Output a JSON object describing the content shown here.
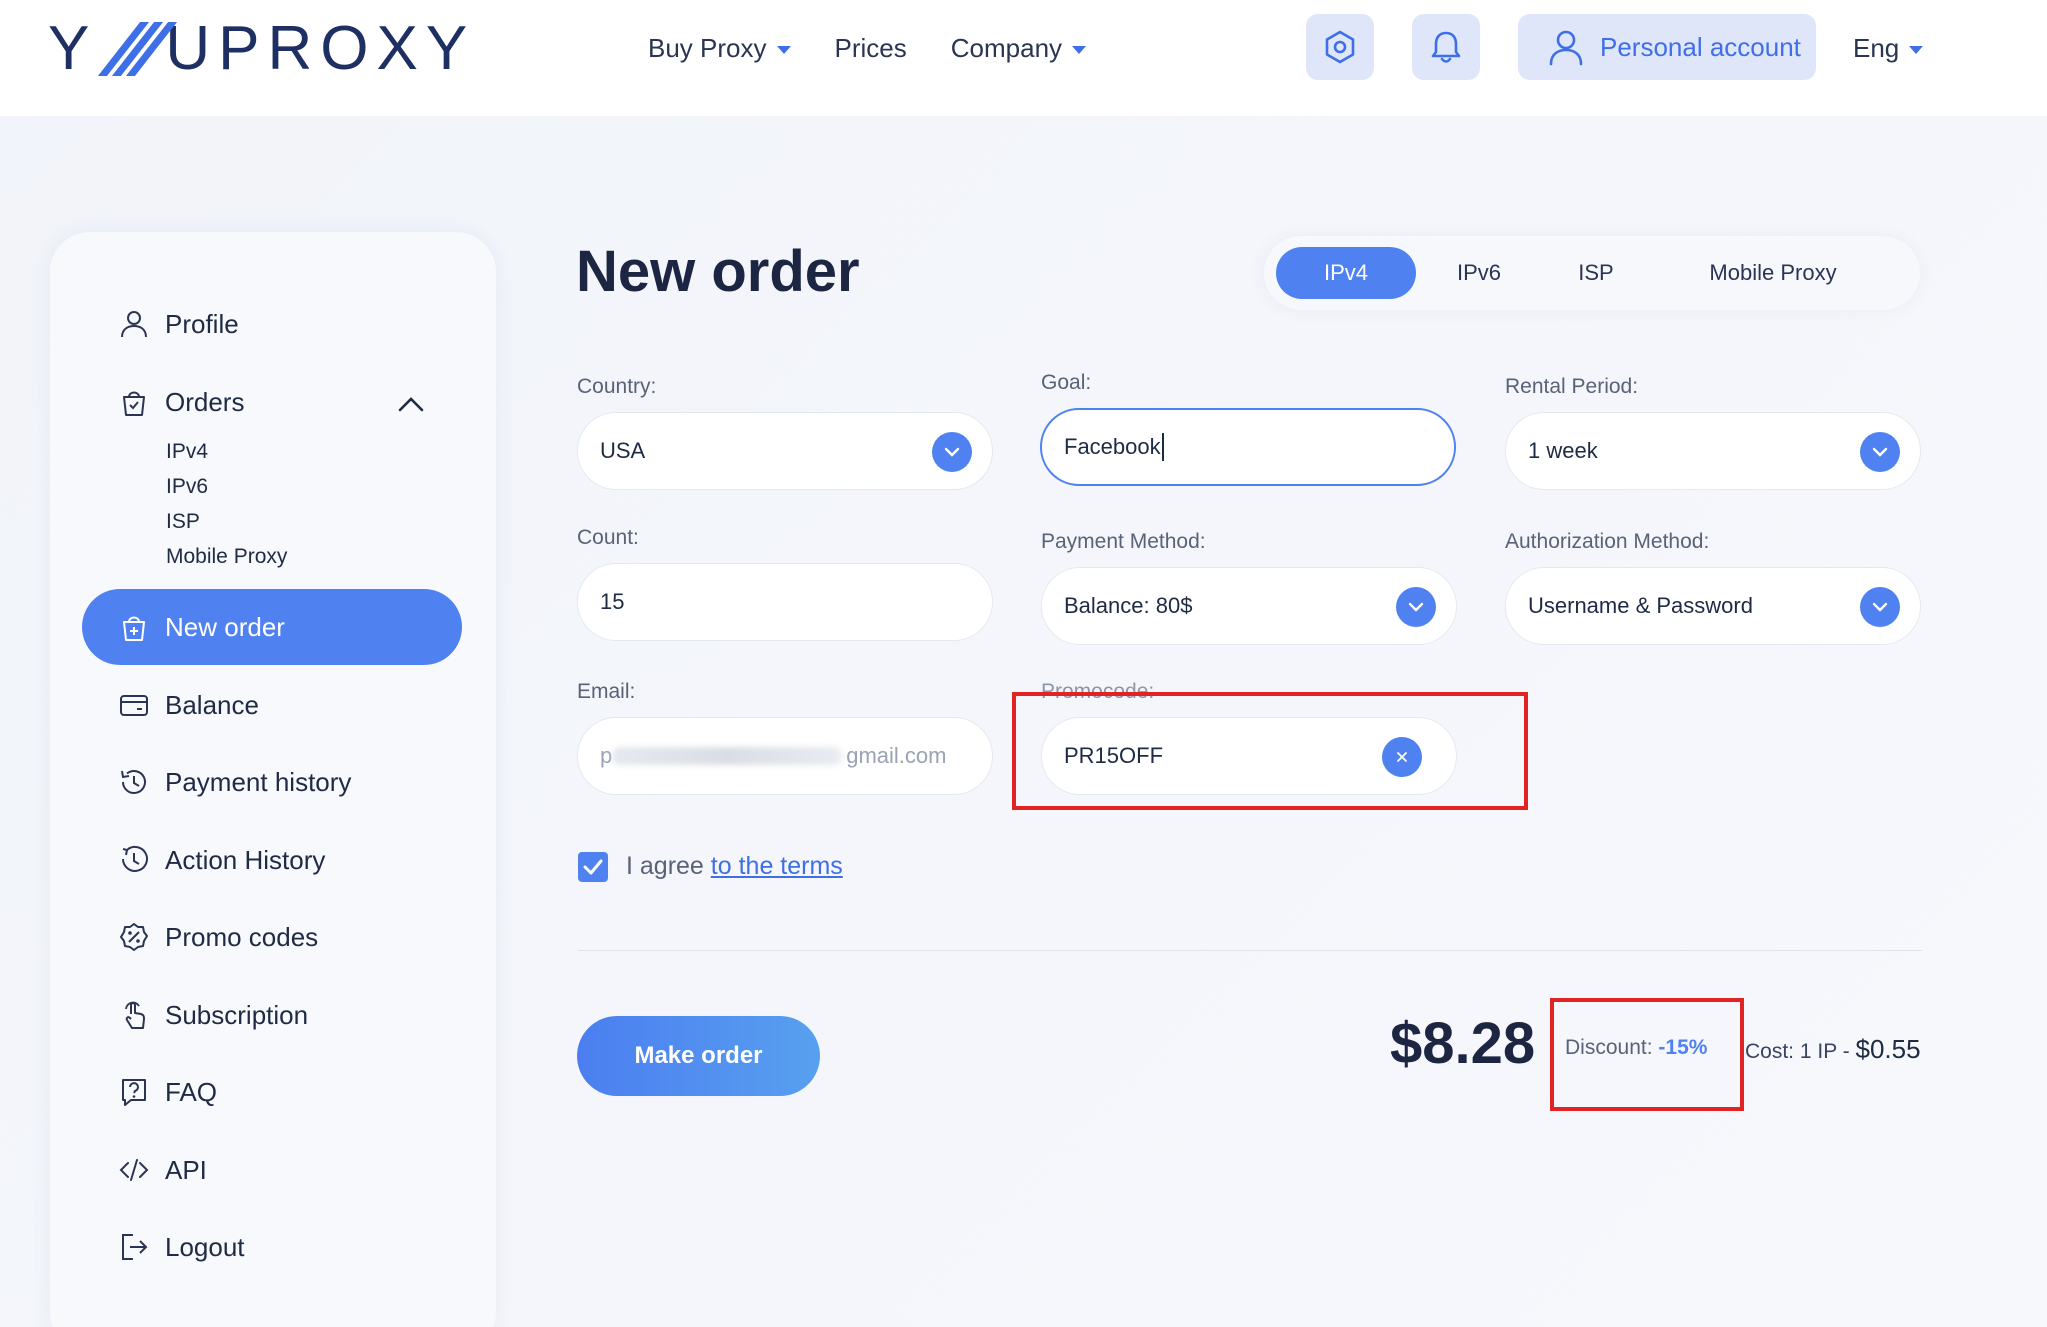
{
  "header": {
    "logo": {
      "left": "Y",
      "right": "UPROXY"
    },
    "nav": [
      {
        "label": "Buy Proxy",
        "dropdown": true
      },
      {
        "label": "Prices",
        "dropdown": false
      },
      {
        "label": "Company",
        "dropdown": true
      }
    ],
    "account_label": "Personal account",
    "language": "Eng"
  },
  "sidebar": {
    "items": [
      {
        "label": "Profile",
        "icon": "user-icon"
      },
      {
        "label": "Orders",
        "icon": "bag-icon"
      },
      {
        "label": "New order",
        "icon": "new-order-icon",
        "active": true
      },
      {
        "label": "Balance",
        "icon": "card-icon"
      },
      {
        "label": "Payment history",
        "icon": "history-icon"
      },
      {
        "label": "Action History",
        "icon": "clock-icon"
      },
      {
        "label": "Promo codes",
        "icon": "percent-badge-icon"
      },
      {
        "label": "Subscription",
        "icon": "touch-icon"
      },
      {
        "label": "FAQ",
        "icon": "question-icon"
      },
      {
        "label": "API",
        "icon": "code-icon"
      },
      {
        "label": "Logout",
        "icon": "logout-icon"
      }
    ],
    "order_subitems": [
      "IPv4",
      "IPv6",
      "ISP",
      "Mobile Proxy"
    ]
  },
  "main": {
    "title": "New order",
    "tabs": [
      {
        "label": "IPv4",
        "active": true
      },
      {
        "label": "IPv6",
        "active": false
      },
      {
        "label": "ISP",
        "active": false
      },
      {
        "label": "Mobile Proxy",
        "active": false
      }
    ],
    "form": {
      "country": {
        "label": "Country:",
        "value": "USA"
      },
      "goal": {
        "label": "Goal:",
        "value": "Facebook"
      },
      "rental_period": {
        "label": "Rental Period:",
        "value": "1 week"
      },
      "count": {
        "label": "Count:",
        "value": "15"
      },
      "payment_method": {
        "label": "Payment Method:",
        "value": "Balance: 80$"
      },
      "authorization_method": {
        "label": "Authorization Method:",
        "value": "Username & Password"
      },
      "email": {
        "label": "Email:",
        "value_prefix": "p",
        "value_suffix": "gmail.com"
      },
      "promocode": {
        "label": "Promocode:",
        "value": "PR15OFF"
      }
    },
    "terms": {
      "text": "I agree",
      "link": "to the terms",
      "checked": true
    },
    "order_button": "Make order",
    "total": "$8.28",
    "discount": {
      "label": "Discount:",
      "value": "-15%"
    },
    "cost": {
      "label": "Cost: 1 IP -",
      "value": "$0.55"
    }
  },
  "colors": {
    "accent": "#4f82f0",
    "highlight": "#e02424",
    "text": "#1f2a44"
  }
}
